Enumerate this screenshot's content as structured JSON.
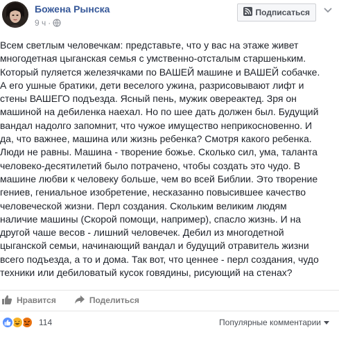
{
  "header": {
    "author": "Божена Рынска",
    "time": "9 ч",
    "subscribe_label": "Подписаться",
    "icons": {
      "avatar": "avatar",
      "globe": "globe-icon",
      "subscribe": "rss-subscribe-icon",
      "menu": "chevron-down-icon"
    }
  },
  "post": {
    "lines": [
      "Всем светлым человечкам: представьте, что у вас на этаже живет",
      "многодетная цыганская семья с умственно-отсталым старшеньким.",
      "Который пуляется железячками по ВАШЕЙ машине и ВАШЕЙ собачке.",
      "А его ушные братики, дети веселого ужина, разрисовывают лифт и",
      "стены ВАШЕГО подъезда. Ясный пень, мужик овереакted. Зря он",
      "машиной на дебиленка наехал. Но по шее дать должен был. Будущий",
      "вандал надолго запомнит, что чужое имущество неприкосновенно. И",
      "да, что важнее, машина или жизнь ребенка? Смотря какого ребенка.",
      "Люди не равны. Машина - творение божье. Сколько сил, ума, таланта",
      "человеко-десятилетий было потрачено, чтобы создать это чудо. В",
      "машине любви к человеку больше, чем во всей Библии. Это творение",
      "гениев, гениальное изобретение, несказанно повысившее качество",
      "человеческой жизни. Перл создания. Скольким великим людям",
      "наличие машины (Скорой помощи, например), спасло жизнь. И на",
      "другой чаше весов - лишний человечек. Дебил из многодетной",
      "цыганской семьи, начинающий вандал и будущий отравитель жизни",
      "всего подъезда, а то и дома. Так вот, что ценнее - перл создания, чудо",
      "техники или дебиловатый кусок говядины, рисующий на стенах?"
    ]
  },
  "actions": {
    "like_label": "Нравится",
    "share_label": "Поделиться"
  },
  "footer": {
    "reactions": [
      "like",
      "haha",
      "angry"
    ],
    "reaction_count": "114",
    "sort_label": "Популярные комментарии",
    "sort_icon": "caret-down-icon"
  },
  "colors": {
    "author": "#365899",
    "text": "#1d2129",
    "muted": "#90949c",
    "like_blue": "#5890ff",
    "haha_yellow": "#f7b125",
    "angry_red": "#e9710f"
  }
}
